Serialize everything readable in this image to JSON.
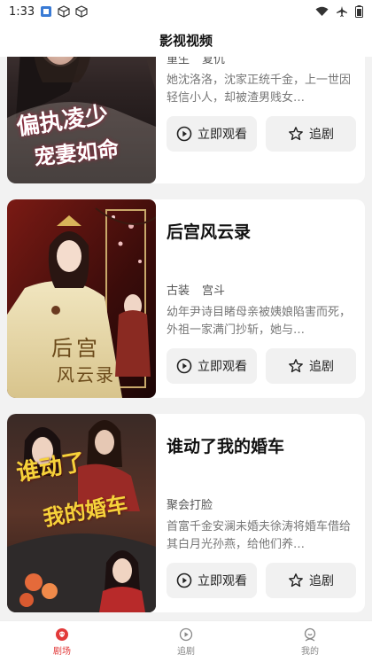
{
  "status_bar": {
    "time": "1:33"
  },
  "header": {
    "title": "影视视频"
  },
  "cards": [
    {
      "title": "",
      "tags": [
        "重生",
        "复仇"
      ],
      "description": "她沈洛洛，沈家正统千金，上一世因轻信小人，却被渣男贱女…",
      "poster_text": [
        "偏执凌少",
        "宠妻如命"
      ],
      "watch_label": "立即观看",
      "follow_label": "追剧"
    },
    {
      "title": "后宫风云录",
      "tags": [
        "古装",
        "宫斗"
      ],
      "description": "幼年尹诗目睹母亲被姨娘陷害而死，外祖一家满门抄斩，她与…",
      "poster_text": [
        "后宫",
        "风云录"
      ],
      "watch_label": "立即观看",
      "follow_label": "追剧"
    },
    {
      "title": "谁动了我的婚车",
      "tags": [
        "聚会打脸"
      ],
      "description": "首富千金安澜未婚夫徐涛将婚车借给其白月光孙燕，给他们养…",
      "poster_text": [
        "谁动了",
        "我的婚车"
      ],
      "watch_label": "立即观看",
      "follow_label": "追剧"
    }
  ],
  "tabbar": {
    "items": [
      {
        "label": "剧场",
        "icon": "theater-icon",
        "active": true
      },
      {
        "label": "追剧",
        "icon": "play-circle-icon",
        "active": false
      },
      {
        "label": "我的",
        "icon": "profile-icon",
        "active": false
      }
    ]
  },
  "colors": {
    "accent": "#e23a3a",
    "background": "#f2f2f2"
  }
}
